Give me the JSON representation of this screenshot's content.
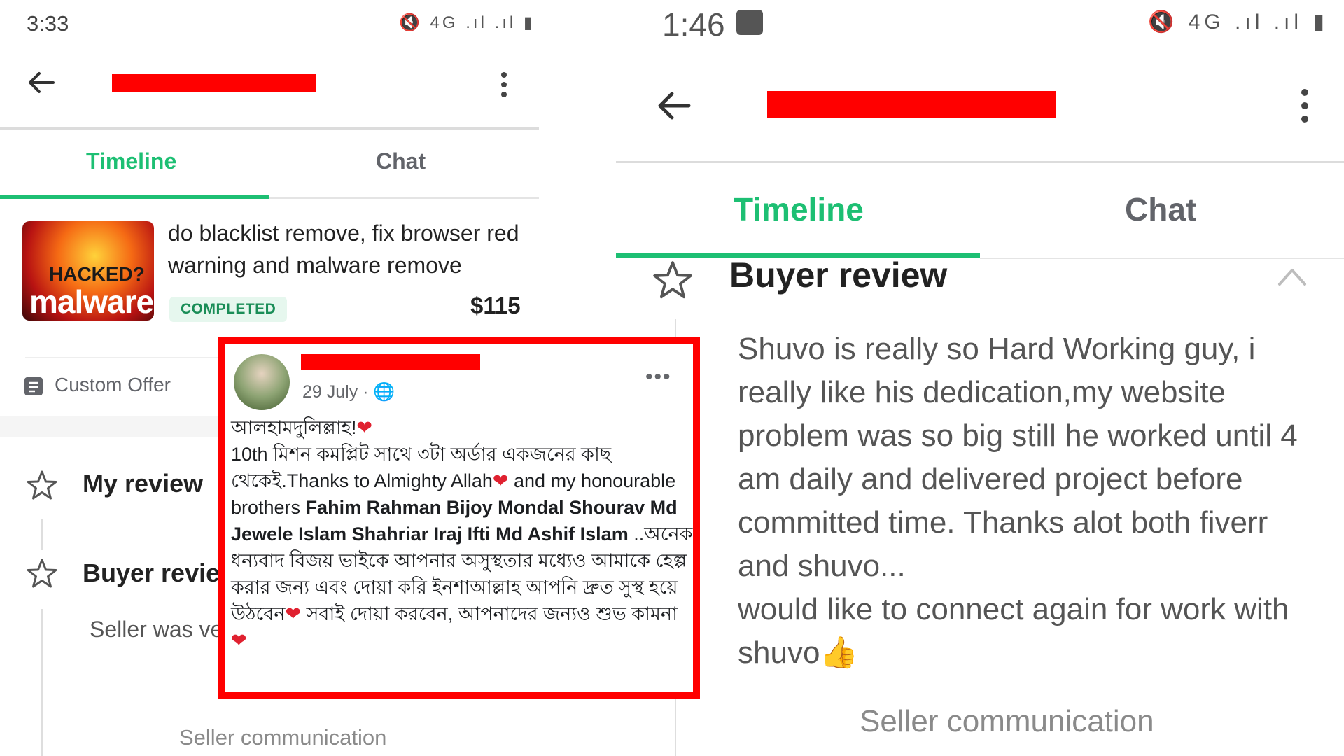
{
  "left": {
    "status": {
      "time": "3:33",
      "icons": "🔇 4G .ıl .ıl ▮"
    },
    "tabs": {
      "timeline": "Timeline",
      "chat": "Chat"
    },
    "order": {
      "thumb_word1": "HACKED?",
      "thumb_word2": "malware",
      "title": "do blacklist remove, fix browser red warning and malware remove",
      "status": "COMPLETED",
      "price": "$115"
    },
    "custom_offer": "Custom Offer",
    "my_review": "My review",
    "buyer_review": "Buyer revie",
    "review_text": "Seller was ve took a profe various issue",
    "seller_communication": "Seller communication"
  },
  "post": {
    "date": "29 July · 🌐",
    "more": "•••",
    "line1": "আলহামদুলিল্লাহ!",
    "line2a": "10th মিশন কমপ্লিট সাথে ৩টা অর্ডার একজনের কাছ থেকেই.Thanks to Almighty Allah",
    "line2b": " and my honourable brothers ",
    "names": "Fahim Rahman Bijoy Mondal Shourav Md Jewele Islam Shahriar Iraj Ifti Md Ashif Islam",
    "line3": " ..অনেক ধন্যবাদ বিজয় ভাইকে আপনার অসুস্থতার মধ্যেও আমাকে হেল্প করার জন্য এবং দোয়া করি ইনশাআল্লাহ আপনি দ্রুত সুস্থ হয়ে উঠবেন",
    "line4": " সবাই দোয়া করবেন, আপনাদের জন্যও শুভ কামনা",
    "heart": "❤"
  },
  "right": {
    "status": {
      "time": "1:46",
      "icons": "🔇 4G .ıl .ıl ▮"
    },
    "tabs": {
      "timeline": "Timeline",
      "chat": "Chat"
    },
    "buyer_review": "Buyer review",
    "review_text": "Shuvo is really so Hard Working guy, i really like his dedication,my website problem was so big still he worked until 4 am daily and delivered project before committed time. Thanks alot both fiverr and shuvo...",
    "review_text2": "would like to connect again for work with shuvo",
    "thumb_emoji": "👍",
    "seller_communication": "Seller communication"
  },
  "colors": {
    "accent": "#1dbf73",
    "redaction": "#ff0000",
    "heart": "#e02130"
  }
}
